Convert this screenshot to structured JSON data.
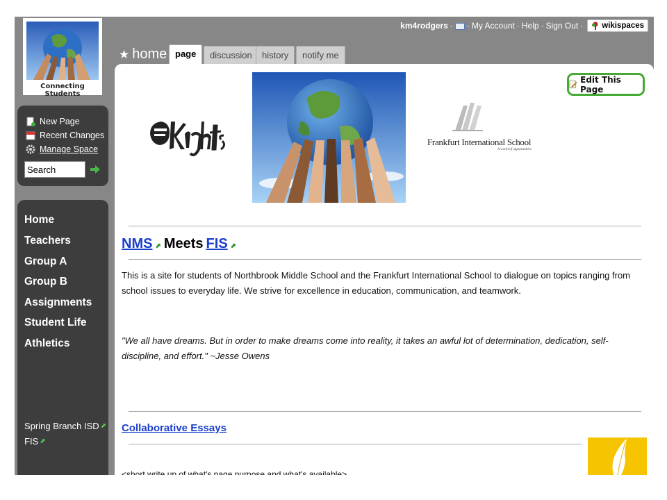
{
  "site": {
    "logo_caption": "Connecting Students"
  },
  "tools": {
    "new_page": "New Page",
    "recent_changes": "Recent Changes",
    "manage_space": "Manage Space",
    "search_value": "Search"
  },
  "nav": {
    "items": [
      {
        "label": "Home"
      },
      {
        "label": "Teachers"
      },
      {
        "label": "Group A"
      },
      {
        "label": "Group B"
      },
      {
        "label": "Assignments"
      },
      {
        "label": "Student Life"
      },
      {
        "label": "Athletics"
      }
    ],
    "external_links": [
      {
        "label": "Spring Branch ISD"
      },
      {
        "label": "FIS"
      }
    ]
  },
  "userbar": {
    "username": "km4rodgers",
    "sep": "·",
    "my_account": "My Account",
    "help": "Help",
    "sign_out": "Sign Out",
    "brand": "wikispaces"
  },
  "page": {
    "name": "home",
    "tabs": [
      "page",
      "discussion",
      "history",
      "notify me"
    ],
    "active_tab": "page",
    "edit_label": "Edit This Page"
  },
  "content": {
    "fis_logo_text": "Frankfurt International School",
    "fis_logo_tagline": "A world of opportunities",
    "title_link1": "NMS",
    "title_middle": "Meets",
    "title_link2": "FIS",
    "intro": "This is a site for students of Northbrook Middle School and the Frankfurt International School to dialogue on topics ranging from school issues to everyday life. We strive for excellence in education, communication, and teamwork.",
    "quote": "\"We all have dreams. But in order to make dreams come into reality, it takes an awful lot of determination, dedication, self-discipline, and effort.\" ~Jesse Owens",
    "essays_heading": "Collaborative Essays",
    "cutoff_text": "<short write up of what's page purpose and what's available>"
  },
  "colors": {
    "frame_gray": "#878787",
    "panel_dark": "#3d3d3d",
    "link_blue": "#1a3fcc",
    "edit_green": "#44aa33",
    "thumb_yellow": "#f6c400"
  }
}
